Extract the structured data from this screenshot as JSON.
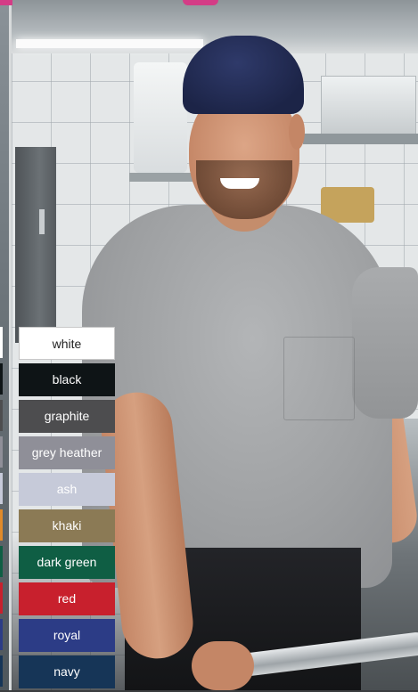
{
  "swatches": [
    {
      "label": "white",
      "bg": "#ffffff",
      "fg": "#222222"
    },
    {
      "label": "black",
      "bg": "#0e1416",
      "fg": "#ffffff"
    },
    {
      "label": "graphite",
      "bg": "#4d4d4f",
      "fg": "#ffffff"
    },
    {
      "label": "grey heather",
      "bg": "#8f8f98",
      "fg": "#ffffff"
    },
    {
      "label": "ash",
      "bg": "#c6cad9",
      "fg": "#ffffff"
    },
    {
      "label": "khaki",
      "bg": "#8b7a55",
      "fg": "#ffffff"
    },
    {
      "label": "dark green",
      "bg": "#0f5e44",
      "fg": "#ffffff"
    },
    {
      "label": "red",
      "bg": "#c8202d",
      "fg": "#ffffff"
    },
    {
      "label": "royal",
      "bg": "#2c3c86",
      "fg": "#ffffff"
    },
    {
      "label": "navy",
      "bg": "#163557",
      "fg": "#ffffff"
    }
  ],
  "colors": {
    "accent_pink": "#d43c86",
    "shirt_grey": "#a4a6a8",
    "cap_navy": "#1f2750"
  },
  "edge_colors": [
    "#ffffff",
    "#0e1416",
    "#4d4d4f",
    "#8f8f98",
    "#c6cad9",
    "#e08a2a",
    "#0f5e44",
    "#c8202d",
    "#2c3c86",
    "#163557"
  ]
}
